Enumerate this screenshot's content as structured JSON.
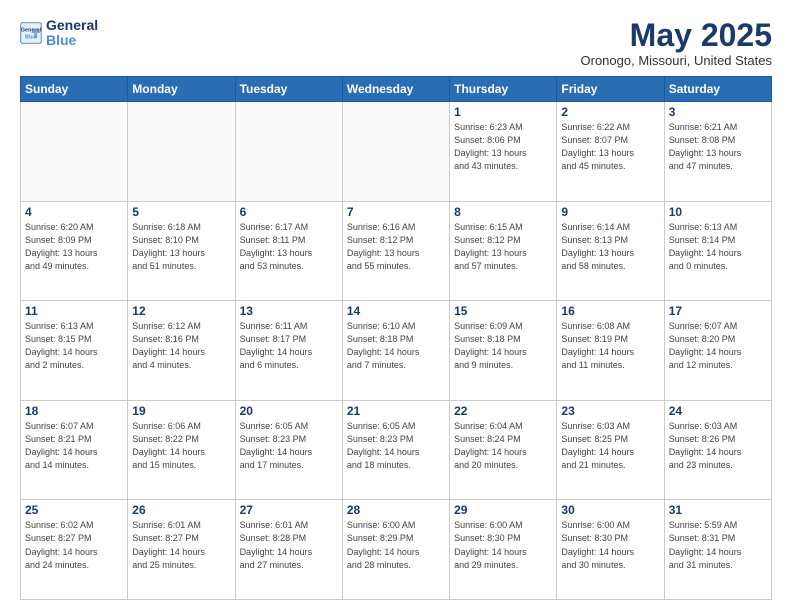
{
  "header": {
    "logo_line1": "General",
    "logo_line2": "Blue",
    "title": "May 2025",
    "subtitle": "Oronogo, Missouri, United States"
  },
  "calendar": {
    "headers": [
      "Sunday",
      "Monday",
      "Tuesday",
      "Wednesday",
      "Thursday",
      "Friday",
      "Saturday"
    ],
    "rows": [
      [
        {
          "day": "",
          "info": ""
        },
        {
          "day": "",
          "info": ""
        },
        {
          "day": "",
          "info": ""
        },
        {
          "day": "",
          "info": ""
        },
        {
          "day": "1",
          "info": "Sunrise: 6:23 AM\nSunset: 8:06 PM\nDaylight: 13 hours\nand 43 minutes."
        },
        {
          "day": "2",
          "info": "Sunrise: 6:22 AM\nSunset: 8:07 PM\nDaylight: 13 hours\nand 45 minutes."
        },
        {
          "day": "3",
          "info": "Sunrise: 6:21 AM\nSunset: 8:08 PM\nDaylight: 13 hours\nand 47 minutes."
        }
      ],
      [
        {
          "day": "4",
          "info": "Sunrise: 6:20 AM\nSunset: 8:09 PM\nDaylight: 13 hours\nand 49 minutes."
        },
        {
          "day": "5",
          "info": "Sunrise: 6:18 AM\nSunset: 8:10 PM\nDaylight: 13 hours\nand 51 minutes."
        },
        {
          "day": "6",
          "info": "Sunrise: 6:17 AM\nSunset: 8:11 PM\nDaylight: 13 hours\nand 53 minutes."
        },
        {
          "day": "7",
          "info": "Sunrise: 6:16 AM\nSunset: 8:12 PM\nDaylight: 13 hours\nand 55 minutes."
        },
        {
          "day": "8",
          "info": "Sunrise: 6:15 AM\nSunset: 8:12 PM\nDaylight: 13 hours\nand 57 minutes."
        },
        {
          "day": "9",
          "info": "Sunrise: 6:14 AM\nSunset: 8:13 PM\nDaylight: 13 hours\nand 58 minutes."
        },
        {
          "day": "10",
          "info": "Sunrise: 6:13 AM\nSunset: 8:14 PM\nDaylight: 14 hours\nand 0 minutes."
        }
      ],
      [
        {
          "day": "11",
          "info": "Sunrise: 6:13 AM\nSunset: 8:15 PM\nDaylight: 14 hours\nand 2 minutes."
        },
        {
          "day": "12",
          "info": "Sunrise: 6:12 AM\nSunset: 8:16 PM\nDaylight: 14 hours\nand 4 minutes."
        },
        {
          "day": "13",
          "info": "Sunrise: 6:11 AM\nSunset: 8:17 PM\nDaylight: 14 hours\nand 6 minutes."
        },
        {
          "day": "14",
          "info": "Sunrise: 6:10 AM\nSunset: 8:18 PM\nDaylight: 14 hours\nand 7 minutes."
        },
        {
          "day": "15",
          "info": "Sunrise: 6:09 AM\nSunset: 8:18 PM\nDaylight: 14 hours\nand 9 minutes."
        },
        {
          "day": "16",
          "info": "Sunrise: 6:08 AM\nSunset: 8:19 PM\nDaylight: 14 hours\nand 11 minutes."
        },
        {
          "day": "17",
          "info": "Sunrise: 6:07 AM\nSunset: 8:20 PM\nDaylight: 14 hours\nand 12 minutes."
        }
      ],
      [
        {
          "day": "18",
          "info": "Sunrise: 6:07 AM\nSunset: 8:21 PM\nDaylight: 14 hours\nand 14 minutes."
        },
        {
          "day": "19",
          "info": "Sunrise: 6:06 AM\nSunset: 8:22 PM\nDaylight: 14 hours\nand 15 minutes."
        },
        {
          "day": "20",
          "info": "Sunrise: 6:05 AM\nSunset: 8:23 PM\nDaylight: 14 hours\nand 17 minutes."
        },
        {
          "day": "21",
          "info": "Sunrise: 6:05 AM\nSunset: 8:23 PM\nDaylight: 14 hours\nand 18 minutes."
        },
        {
          "day": "22",
          "info": "Sunrise: 6:04 AM\nSunset: 8:24 PM\nDaylight: 14 hours\nand 20 minutes."
        },
        {
          "day": "23",
          "info": "Sunrise: 6:03 AM\nSunset: 8:25 PM\nDaylight: 14 hours\nand 21 minutes."
        },
        {
          "day": "24",
          "info": "Sunrise: 6:03 AM\nSunset: 8:26 PM\nDaylight: 14 hours\nand 23 minutes."
        }
      ],
      [
        {
          "day": "25",
          "info": "Sunrise: 6:02 AM\nSunset: 8:27 PM\nDaylight: 14 hours\nand 24 minutes."
        },
        {
          "day": "26",
          "info": "Sunrise: 6:01 AM\nSunset: 8:27 PM\nDaylight: 14 hours\nand 25 minutes."
        },
        {
          "day": "27",
          "info": "Sunrise: 6:01 AM\nSunset: 8:28 PM\nDaylight: 14 hours\nand 27 minutes."
        },
        {
          "day": "28",
          "info": "Sunrise: 6:00 AM\nSunset: 8:29 PM\nDaylight: 14 hours\nand 28 minutes."
        },
        {
          "day": "29",
          "info": "Sunrise: 6:00 AM\nSunset: 8:30 PM\nDaylight: 14 hours\nand 29 minutes."
        },
        {
          "day": "30",
          "info": "Sunrise: 6:00 AM\nSunset: 8:30 PM\nDaylight: 14 hours\nand 30 minutes."
        },
        {
          "day": "31",
          "info": "Sunrise: 5:59 AM\nSunset: 8:31 PM\nDaylight: 14 hours\nand 31 minutes."
        }
      ]
    ]
  }
}
